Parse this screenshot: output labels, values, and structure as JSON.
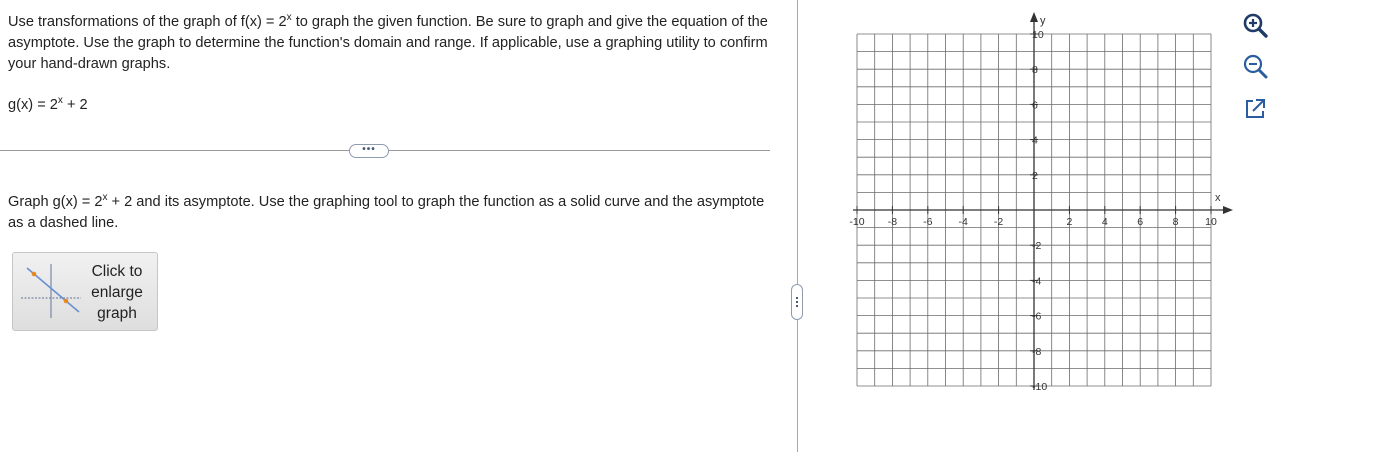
{
  "problem": {
    "intro_part1": "Use transformations of the graph of f(x) = 2",
    "intro_exp": "x",
    "intro_part2": " to graph the given function. Be sure to graph and give the equation of the asymptote. Use the graph to determine the function's domain and range. If applicable, use a graphing utility to confirm your hand-drawn graphs.",
    "func_pre": "g(x) = 2",
    "func_exp": "x",
    "func_post": " + 2"
  },
  "divider": {
    "more_label": "•••"
  },
  "instruction": {
    "part1": "Graph g(x) = 2",
    "exp": "x",
    "part2": " + 2 and its asymptote. Use the graphing tool to graph the function as a solid curve and the asymptote as a dashed line."
  },
  "enlarge_button": {
    "label": "Click to enlarge graph"
  },
  "graph": {
    "x_label": "x",
    "y_label": "y",
    "x_ticks": [
      "-10",
      "-8",
      "-6",
      "-4",
      "-2",
      "2",
      "4",
      "6",
      "8",
      "10"
    ],
    "y_ticks": [
      "10",
      "8",
      "6",
      "4",
      "2",
      "-2",
      "-4",
      "-6",
      "-8",
      "-10"
    ],
    "xlim": [
      -10,
      10
    ],
    "ylim": [
      -10,
      10
    ],
    "grid_step": 1,
    "grid": true,
    "grid_color": "#6b6b6b",
    "axis_color": "#333333"
  },
  "tools": {
    "zoom_in": "zoom-in-icon",
    "zoom_out": "zoom-out-icon",
    "popout": "popout-icon"
  },
  "colors": {
    "accent": "#2a5d9f",
    "thumb_point": "#e8891f"
  }
}
